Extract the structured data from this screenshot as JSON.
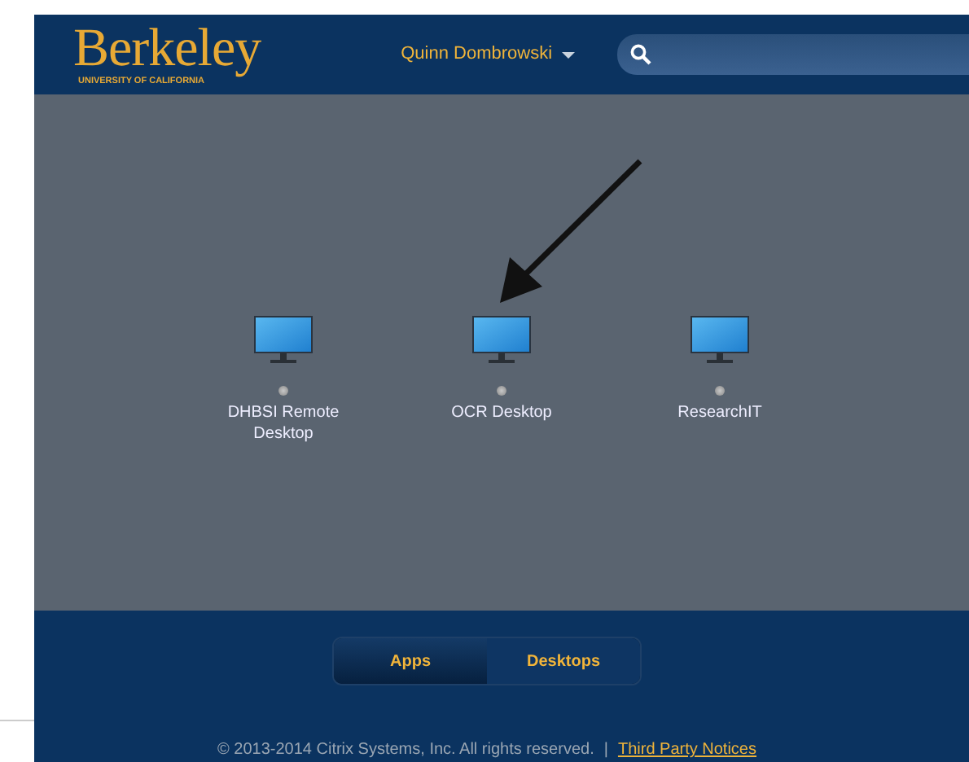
{
  "header": {
    "logo": "Berkeley",
    "logo_subtitle": "UNIVERSITY OF CALIFORNIA",
    "user_menu": "Quinn Dombrowski"
  },
  "desktops": [
    {
      "name": "DHBSI Remote Desktop"
    },
    {
      "name": "OCR Desktop"
    },
    {
      "name": "ResearchIT"
    }
  ],
  "tabs": [
    {
      "label": "Apps",
      "selected": false
    },
    {
      "label": "Desktops",
      "selected": true
    }
  ],
  "footer": {
    "copyright": "© 2013-2014 Citrix Systems, Inc. All rights reserved.",
    "separator": "|",
    "link": "Third Party Notices"
  }
}
